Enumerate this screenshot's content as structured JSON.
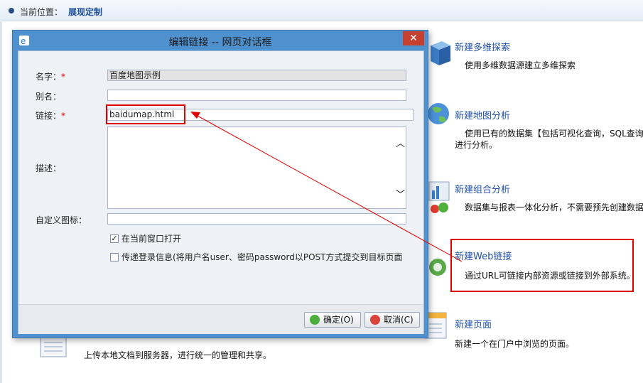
{
  "breadcrumb": {
    "label": "当前位置：",
    "current": "展现定制"
  },
  "features": [
    {
      "title": "新建多维探索",
      "desc": "使用多维数据源建立多维探索"
    },
    {
      "title": "新建地图分析",
      "desc1": "使用已有的数据集【包括可视化查询，SQL查询",
      "desc2": "进行分析。"
    },
    {
      "title": "新建组合分析",
      "desc": "数据集与报表一体化分析，不需要预先创建数据"
    },
    {
      "title": "新建Web链接",
      "desc": "通过URL可链接内部资源或链接到外部系统。"
    },
    {
      "title": "新建页面",
      "desc": "新建一个在门户中浏览的页面。"
    }
  ],
  "upload_desc": "上传本地文档到服务器，进行统一的管理和共享。",
  "dialog": {
    "title": "编辑链接 -- 网页对话框",
    "close": "✕",
    "labels": {
      "name": "名字：",
      "alias": "别名：",
      "link": "链接：",
      "desc": "描述：",
      "icon": "自定义图标："
    },
    "required_mark": "*",
    "values": {
      "name": "百度地图示例",
      "alias": "",
      "link": "baidumap.html",
      "icon": ""
    },
    "checkbox1": {
      "label": "在当前窗口打开",
      "checked": true
    },
    "checkbox2": {
      "label": "传递登录信息(将用户名user、密码password以POST方式提交到目标页面",
      "checked": false
    },
    "ok": "确定(O)",
    "cancel": "取消(C)"
  },
  "colors": {
    "accent": "#1f4fa8",
    "highlight": "#e00000",
    "dialog_frame": "#4f91cf"
  }
}
